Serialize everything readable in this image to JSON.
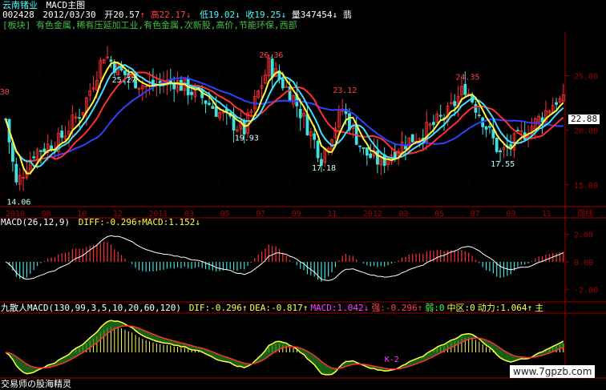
{
  "header": {
    "stock_name": "云南锗业",
    "title": "MACD主图",
    "code": "002428",
    "date": "2012/03/30",
    "open": "开20.57",
    "high": "高22.17",
    "low": "低19.02",
    "close": "收19.25",
    "volume": "量347454",
    "extra": "翡",
    "sector_line": "[板块] 有色金属,稀有压延加工业,有色金属,次新股,高价,节能环保,西部"
  },
  "price_badge": "22.88",
  "chart_data": [
    {
      "type": "candlestick",
      "panel": "price",
      "x_ticks": [
        "2010",
        "08",
        "10",
        "12",
        "2011",
        "03",
        "05",
        "07",
        "09",
        "11",
        "2012",
        "03",
        "05",
        "07",
        "09",
        "11"
      ],
      "x_axis_unit": "周线",
      "y_ticks": [
        "25.00",
        "20.00",
        "15.00"
      ],
      "ylim": [
        13,
        29
      ],
      "series": [
        {
          "name": "MA-yellow",
          "color": "#ffff40"
        },
        {
          "name": "MA-cyan",
          "color": "#40e0ff"
        },
        {
          "name": "MA-red",
          "color": "#ff3030"
        },
        {
          "name": "MA-blue",
          "color": "#3040ff"
        }
      ],
      "annotations": [
        {
          "text": "30",
          "x_index": 1,
          "y": 23.0,
          "color": "#ff4040"
        },
        {
          "text": "14.06",
          "x_index": 3,
          "y": 14.06,
          "color": "#c0ffff"
        },
        {
          "text": "25.27",
          "x_index": 33,
          "y": 25.27,
          "color": "#c0ffff"
        },
        {
          "text": "26.36",
          "x_index": 75,
          "y": 26.36,
          "color": "#ff4040"
        },
        {
          "text": "19.93",
          "x_index": 68,
          "y": 19.93,
          "color": "#c0ffff"
        },
        {
          "text": "23.12",
          "x_index": 96,
          "y": 23.12,
          "color": "#ff4040"
        },
        {
          "text": "17.18",
          "x_index": 90,
          "y": 17.18,
          "color": "#c0ffff"
        },
        {
          "text": "24.35",
          "x_index": 131,
          "y": 24.35,
          "color": "#ff4040"
        },
        {
          "text": "17.55",
          "x_index": 141,
          "y": 17.55,
          "color": "#c0ffff"
        }
      ]
    },
    {
      "type": "bar",
      "panel": "macd",
      "title": "MACD(26,12,9)",
      "legend": "DIFF:-0.296↑MACD:1.152↓",
      "y_ticks": [
        "2.00",
        "0.00",
        "-2.00"
      ],
      "ylim": [
        -2.5,
        2.5
      ]
    },
    {
      "type": "area",
      "panel": "nine",
      "title": "九散人MACD(130,99,3,5,10,20,60,120)",
      "legend": [
        {
          "text": "DIF:-0.296↑",
          "color": "#ffff40"
        },
        {
          "text": "DEA:-0.817↑",
          "color": "#ffff40"
        },
        {
          "text": "MACD:1.042↓",
          "color": "#ff40ff"
        },
        {
          "text": "强:-0.296↑",
          "color": "#ff4040"
        },
        {
          "text": "弱:0",
          "color": "#40ff40"
        },
        {
          "text": "中区:0",
          "color": "#ffff40"
        },
        {
          "text": "动力:1.064↑",
          "color": "#ffff40"
        },
        {
          "text": "主",
          "color": "#ffff40"
        }
      ],
      "annotation": "K-2"
    }
  ],
  "footer": {
    "bottom_label": "交易师の股海精灵",
    "watermark": "www.7gpzb.com"
  },
  "colors": {
    "up": "#ff3030",
    "down": "#40e0e0",
    "axis": "#a00000",
    "text_white": "#ffffff",
    "text_cyan": "#40ffff",
    "text_yellow": "#ffff40",
    "text_red": "#ff4040",
    "text_green": "#40ff40"
  }
}
